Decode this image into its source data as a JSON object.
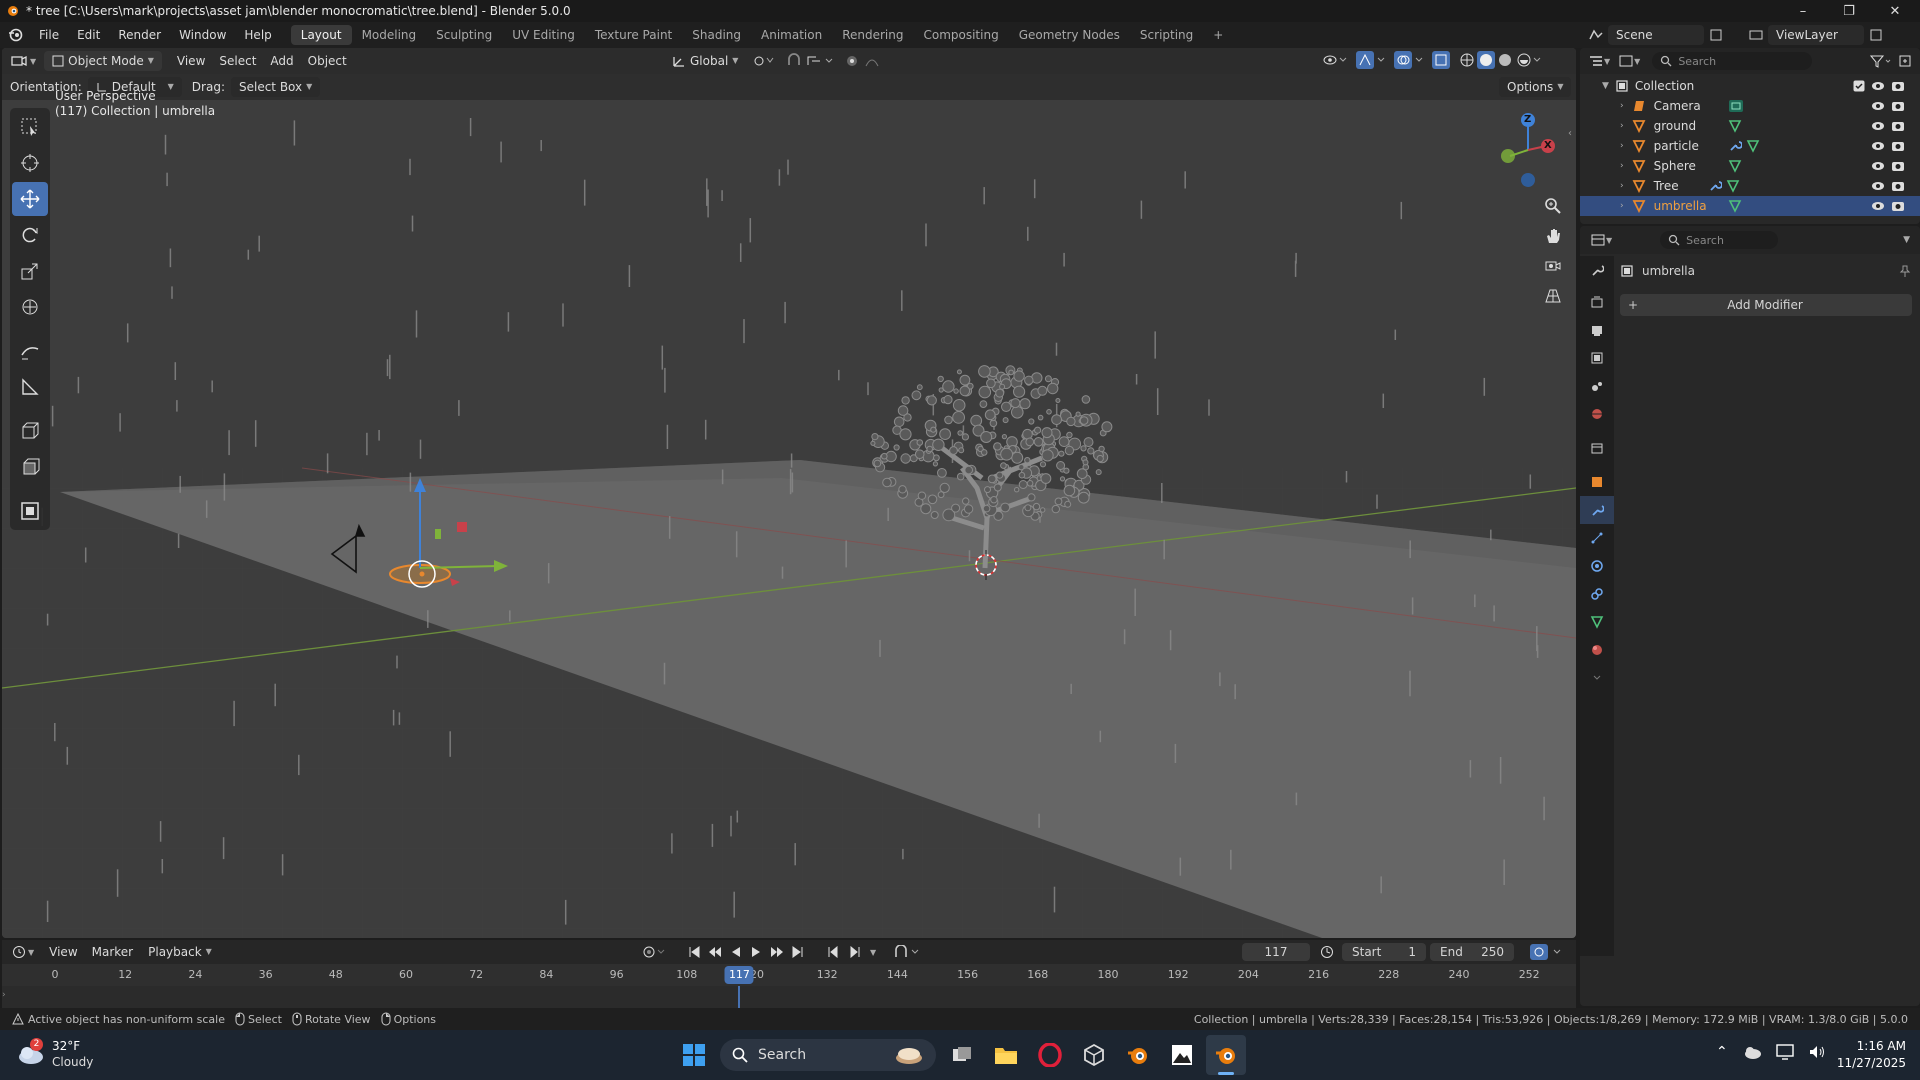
{
  "window": {
    "title": "* tree [C:\\Users\\mark\\projects\\asset jam\\blender monocromatic\\tree.blend] - Blender 5.0.0",
    "minimize": "–",
    "maximize": "❐",
    "close": "✕"
  },
  "menu": {
    "items": [
      "File",
      "Edit",
      "Render",
      "Window",
      "Help"
    ],
    "workspaces": [
      "Layout",
      "Modeling",
      "Sculpting",
      "UV Editing",
      "Texture Paint",
      "Shading",
      "Animation",
      "Rendering",
      "Compositing",
      "Geometry Nodes",
      "Scripting"
    ],
    "add_tab": "+",
    "scene": "Scene",
    "view_layer": "ViewLayer"
  },
  "viewport": {
    "mode": "Object Mode",
    "menus": [
      "View",
      "Select",
      "Add",
      "Object"
    ],
    "transform_orientation": "Global",
    "orientation_label": "Orientation:",
    "orientation_value": "Default",
    "drag_label": "Drag:",
    "drag_value": "Select Box",
    "options": "Options",
    "perspective": "User Perspective",
    "info": "(117) Collection | umbrella",
    "gizmo_z": "Z",
    "gizmo_x": "X"
  },
  "outliner": {
    "search_placeholder": "Search",
    "collection": "Collection",
    "items": [
      "Camera",
      "ground",
      "particle",
      "Sphere",
      "Tree",
      "umbrella"
    ]
  },
  "properties": {
    "search_placeholder": "Search",
    "object_name": "umbrella",
    "add_modifier": "Add Modifier",
    "add_symbol": "+"
  },
  "timeline": {
    "menus": [
      "View",
      "Marker",
      "Playback"
    ],
    "current_frame": "117",
    "start_label": "Start",
    "start": "1",
    "end_label": "End",
    "end": "250",
    "ticks": [
      "0",
      "12",
      "24",
      "36",
      "48",
      "60",
      "72",
      "84",
      "96",
      "108",
      "20",
      "132",
      "144",
      "156",
      "168",
      "180",
      "192",
      "204",
      "216",
      "228",
      "240",
      "252"
    ],
    "playhead": "117"
  },
  "status": {
    "warning": "Active object has non-uniform scale",
    "select": "Select",
    "rotate": "Rotate View",
    "options": "Options",
    "stats": "Collection | umbrella | Verts:28,339 | Faces:28,154 | Tris:53,926 | Objects:1/8,269 | Memory: 172.9 MiB | VRAM: 1.3/8.0 GiB | 5.0.0"
  },
  "taskbar": {
    "temperature": "32°F",
    "condition": "Cloudy",
    "badge": "2",
    "search": "Search",
    "time": "1:16 AM",
    "date": "11/27/2025"
  },
  "colors": {
    "accent": "#4772b3",
    "selection": "#334d80",
    "object_orange": "#e8882e",
    "axis_x": "#c8414a",
    "axis_y": "#7fb33a",
    "axis_z": "#3f82d8"
  }
}
